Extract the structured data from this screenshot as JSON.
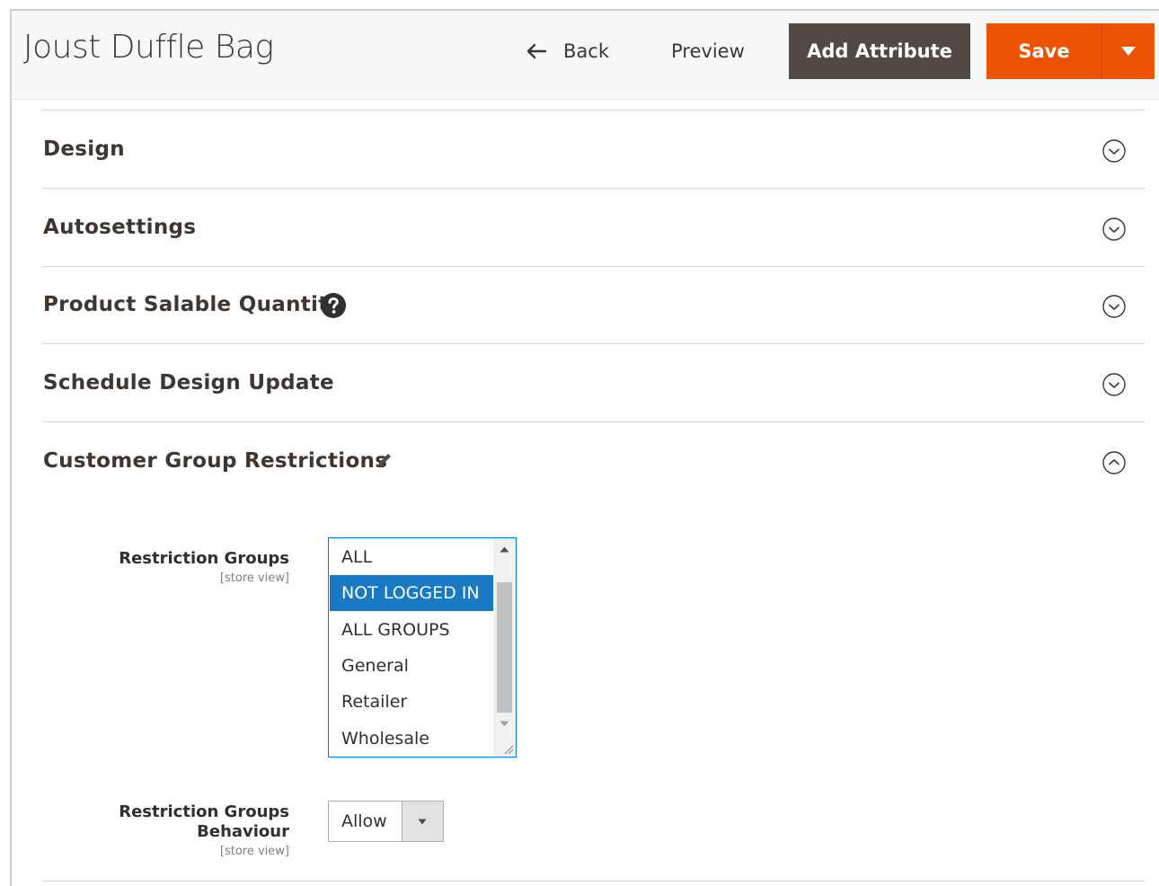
{
  "header": {
    "title": "Joust Duffle Bag",
    "back_label": "Back",
    "preview_label": "Preview",
    "add_attribute_label": "Add Attribute",
    "save_label": "Save"
  },
  "sections": {
    "design": "Design",
    "autosettings": "Autosettings",
    "salable_qty": "Product Salable Quantity",
    "schedule": "Schedule Design Update",
    "restrictions": "Customer Group Restrictions"
  },
  "form": {
    "restriction_groups_label": "Restriction Groups",
    "restriction_groups_scope": "[store view]",
    "restriction_groups_options": [
      "ALL",
      "NOT LOGGED IN",
      "ALL GROUPS",
      "General",
      "Retailer",
      "Wholesale"
    ],
    "restriction_groups_selected": "NOT LOGGED IN",
    "behaviour_label_line1": "Restriction Groups",
    "behaviour_label_line2": "Behaviour",
    "behaviour_scope": "[store view]",
    "behaviour_value": "Allow"
  },
  "colors": {
    "primary_orange": "#eb5202",
    "dark_button": "#514943",
    "selection_blue": "#1979c3"
  },
  "icons": [
    "arrow-left-icon",
    "chevron-down-icon",
    "help-icon",
    "pencil-icon",
    "chevron-up-icon",
    "caret-down-icon"
  ]
}
